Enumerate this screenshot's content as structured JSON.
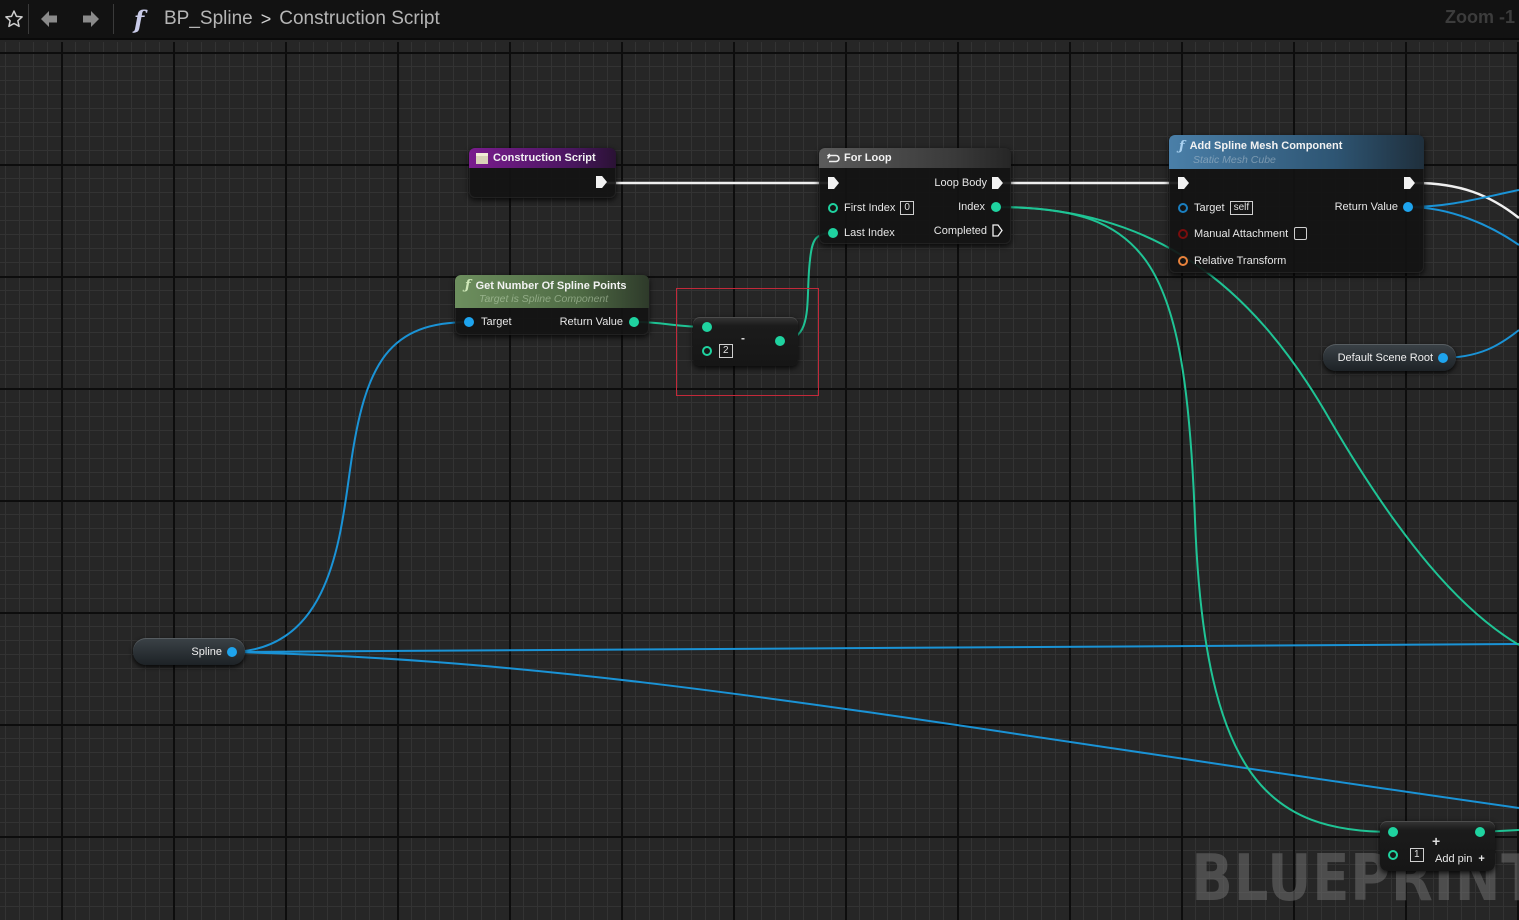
{
  "toolbar": {
    "star_icon": "star-outline-icon",
    "back_icon": "arrow-left-icon",
    "forward_icon": "arrow-right-icon",
    "function_icon": "function-f-icon",
    "function_glyph": "f",
    "breadcrumb": [
      "BP_Spline",
      "Construction Script"
    ],
    "breadcrumb_separator": ">",
    "zoom_label": "Zoom -1"
  },
  "watermark": "BLUEPRINT",
  "colors": {
    "exec": "#f2f2f2",
    "integer_pin": "#1fd3a0",
    "object_pin": "#1ea4ee",
    "bool_pin": "#8a0f0f",
    "transform_pin": "#e8823c",
    "selection": "#c3293a",
    "event_header": "#6a1b7e",
    "pure_function_header": "#5a7a4e",
    "function_header": "#3e6f93",
    "macro_header": "#4b4b4b"
  },
  "nodes": {
    "construction_script": {
      "title": "Construction Script",
      "icon": "event-icon"
    },
    "for_loop": {
      "title": "For Loop",
      "icon": "loop-icon",
      "inputs": [
        {
          "label": "",
          "type": "exec"
        },
        {
          "label": "First Index",
          "type": "int",
          "value": "0"
        },
        {
          "label": "Last Index",
          "type": "int",
          "connected": true
        }
      ],
      "outputs": [
        {
          "label": "Loop Body",
          "type": "exec"
        },
        {
          "label": "Index",
          "type": "int"
        },
        {
          "label": "Completed",
          "type": "exec"
        }
      ]
    },
    "add_spline_mesh": {
      "title": "Add Spline Mesh Component",
      "subtitle": "Static Mesh Cube",
      "icon": "function-icon",
      "inputs": [
        {
          "label": "",
          "type": "exec"
        },
        {
          "label": "Target",
          "type": "object",
          "value": "self"
        },
        {
          "label": "Manual Attachment",
          "type": "bool",
          "checked": false
        },
        {
          "label": "Relative Transform",
          "type": "transform"
        }
      ],
      "outputs": [
        {
          "label": "",
          "type": "exec"
        },
        {
          "label": "Return Value",
          "type": "object"
        }
      ]
    },
    "get_num_spline_points": {
      "title": "Get Number Of Spline Points",
      "subtitle": "Target is Spline Component",
      "icon": "function-icon",
      "inputs": [
        {
          "label": "Target",
          "type": "object"
        }
      ],
      "outputs": [
        {
          "label": "Return Value",
          "type": "int"
        }
      ]
    },
    "subtract": {
      "operator": "-",
      "second_input_value": "2",
      "selected": true
    },
    "default_scene_root": {
      "label": "Default Scene Root"
    },
    "spline_var": {
      "label": "Spline"
    },
    "add_node": {
      "operator": "+",
      "second_input_value": "1",
      "add_pin_label": "Add pin",
      "add_pin_icon": "plus-icon"
    }
  }
}
